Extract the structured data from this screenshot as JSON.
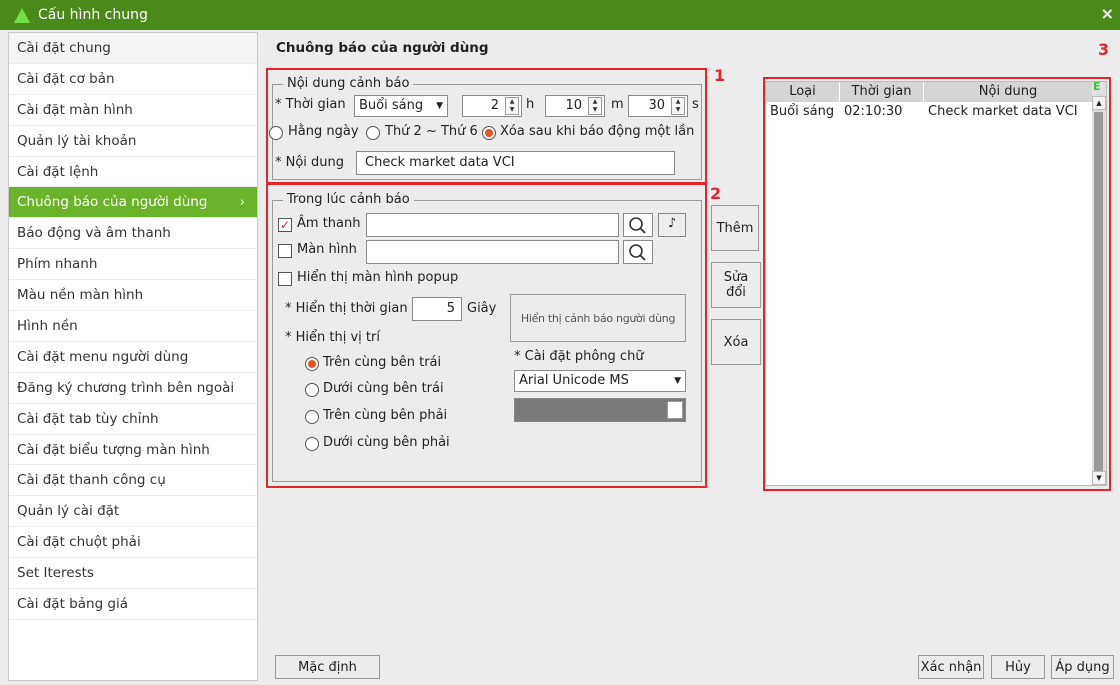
{
  "window": {
    "title": "Cấu hình chung",
    "close": "×"
  },
  "sidebar": {
    "items": [
      {
        "label": "Cài đặt chung"
      },
      {
        "label": "Cài đặt cơ bản"
      },
      {
        "label": "Cài đặt màn hình"
      },
      {
        "label": "Quản lý tài khoản"
      },
      {
        "label": "Cài đặt lệnh"
      },
      {
        "label": "Chuông báo của người dùng",
        "chevron": "›"
      },
      {
        "label": "Báo động và âm thanh"
      },
      {
        "label": "Phím nhanh"
      },
      {
        "label": "Màu nền màn hình"
      },
      {
        "label": "Hình nền"
      },
      {
        "label": "Cài đặt menu người dùng"
      },
      {
        "label": "Đăng ký chương trình bên ngoài"
      },
      {
        "label": "Cài đặt tab tùy chỉnh"
      },
      {
        "label": "Cài đặt biểu tượng màn hình"
      },
      {
        "label": "Cài đặt thanh công cụ"
      },
      {
        "label": "Quản lý cài đặt"
      },
      {
        "label": "Cài đặt chuột phải"
      },
      {
        "label": "Set Iterests"
      },
      {
        "label": "Cài đặt bảng giá"
      }
    ]
  },
  "main": {
    "title": "Chuông báo của người dùng",
    "box_labels": [
      "1",
      "2",
      "3"
    ],
    "alert_content": {
      "legend": "Nội dung cảnh báo",
      "time_label": "* Thời gian",
      "session_value": "Buổi sáng",
      "hour_value": "2",
      "hour_unit": "h",
      "minute_value": "10",
      "minute_unit": "m",
      "second_value": "30",
      "second_unit": "s",
      "repeat_daily": "Hằng ngày",
      "repeat_weekdays": "Thứ 2 ~ Thứ 6",
      "repeat_once": "Xóa sau khi báo động một lần",
      "content_label": "* Nội dung",
      "content_value": "Check market data VCI"
    },
    "during_alert": {
      "legend": "Trong lúc cảnh báo",
      "sound_label": "Âm thanh",
      "sound_checked_mark": "✓",
      "screen_label": "Màn hình",
      "popup_label": "Hiển thị màn hình popup",
      "display_time_label": "* Hiển thị thời gian",
      "display_time_value": "5",
      "display_time_unit": "Giây",
      "display_position_label": "* Hiển thị vị trí",
      "positions": [
        "Trên cùng bên trái",
        "Dưới cùng bên trái",
        "Trên cùng bên phải",
        "Dưới cùng bên phải"
      ],
      "preview_button": "Hiển thị cảnh báo người dùng",
      "font_label": "* Cài đặt phông chữ",
      "font_value": "Arial Unicode MS"
    },
    "actions": {
      "add": "Thêm",
      "edit": "Sửa đổi",
      "delete": "Xóa"
    },
    "alert_list": {
      "columns": [
        "Loại",
        "Thời gian",
        "Nội dung"
      ],
      "corner": "E",
      "rows": [
        {
          "type": "Buổi sáng",
          "time": "02:10:30",
          "content": "Check market data VCI"
        }
      ]
    }
  },
  "footer": {
    "default": "Mặc định",
    "confirm": "Xác nhận",
    "cancel": "Hủy",
    "apply": "Áp dụng"
  },
  "colors": {
    "accent": "#6ab42b",
    "title_bar": "#4a8a1a",
    "highlight": "#e5242e"
  }
}
